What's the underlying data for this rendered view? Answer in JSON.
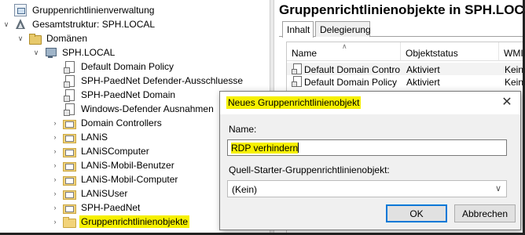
{
  "tree": {
    "items": [
      {
        "label": "Gruppenrichtlinienverwaltung",
        "icon": "gpm-console-icon",
        "twisty": ""
      },
      {
        "label": "Gesamtstruktur: SPH.LOCAL",
        "icon": "forest-icon",
        "twisty": "expanded"
      },
      {
        "label": "Domänen",
        "icon": "domains-folder-icon",
        "twisty": "expanded"
      },
      {
        "label": "SPH.LOCAL",
        "icon": "domain-icon",
        "twisty": "expanded"
      },
      {
        "label": "Default Domain Policy",
        "icon": "gpo-link-icon",
        "twisty": ""
      },
      {
        "label": "SPH-PaedNet Defender-Ausschluesse",
        "icon": "gpo-link-icon",
        "twisty": ""
      },
      {
        "label": "SPH-PaedNet Domain",
        "icon": "gpo-link-icon",
        "twisty": ""
      },
      {
        "label": "Windows-Defender Ausnahmen",
        "icon": "gpo-link-icon",
        "twisty": ""
      },
      {
        "label": "Domain Controllers",
        "icon": "ou-icon",
        "twisty": "collapsed"
      },
      {
        "label": "LANiS",
        "icon": "ou-icon",
        "twisty": "collapsed"
      },
      {
        "label": "LANiSComputer",
        "icon": "ou-icon",
        "twisty": "collapsed"
      },
      {
        "label": "LANiS-Mobil-Benutzer",
        "icon": "ou-icon",
        "twisty": "collapsed"
      },
      {
        "label": "LANiS-Mobil-Computer",
        "icon": "ou-icon",
        "twisty": "collapsed"
      },
      {
        "label": "LANiSUser",
        "icon": "ou-icon",
        "twisty": "collapsed"
      },
      {
        "label": "SPH-PaedNet",
        "icon": "ou-icon",
        "twisty": "collapsed"
      },
      {
        "label": "Gruppenrichtlinienobjekte",
        "icon": "folder-icon",
        "twisty": "collapsed",
        "selected": true
      }
    ]
  },
  "right": {
    "title": "Gruppenrichtlinienobjekte in SPH.LOCAL",
    "tabs": [
      {
        "label": "Inhalt",
        "active": true
      },
      {
        "label": "Delegierung",
        "active": false
      }
    ],
    "columns": [
      "Name",
      "Objektstatus",
      "WMI"
    ],
    "rows": [
      {
        "name": "Default Domain Controll...",
        "status": "Aktiviert",
        "wmi": "Keine"
      },
      {
        "name": "Default Domain Policy",
        "status": "Aktiviert",
        "wmi": "Keine"
      }
    ]
  },
  "dialog": {
    "title": "Neues Gruppenrichtlinienobjekt",
    "close_glyph": "✕",
    "name_label": "Name:",
    "name_value": "RDP verhindern",
    "source_label": "Quell-Starter-Gruppenrichtlinienobjekt:",
    "source_value": "(Kein)",
    "ok_label": "OK",
    "cancel_label": "Abbrechen"
  },
  "colors": {
    "highlight": "#f6f000",
    "default_button_border": "#0078d7"
  }
}
